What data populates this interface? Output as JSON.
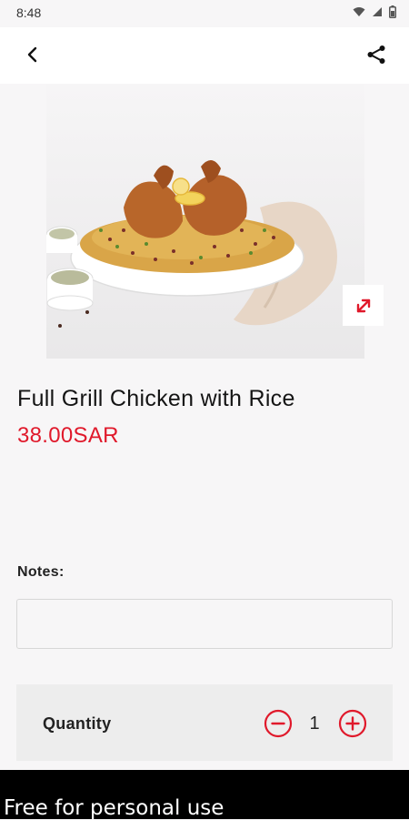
{
  "status_bar": {
    "time": "8:48",
    "icons": [
      "wifi-icon",
      "signal-icon",
      "battery-icon"
    ]
  },
  "app_bar": {
    "back_icon": "back-arrow-icon",
    "share_icon": "share-icon"
  },
  "product": {
    "name": "Full Grill Chicken with Rice",
    "price": "38.00SAR",
    "image_icon": "dish-photo",
    "expand_icon": "expand-icon"
  },
  "notes": {
    "label": "Notes:",
    "value": "",
    "placeholder": ""
  },
  "quantity": {
    "label": "Quantity",
    "value": "1",
    "minus_icon": "minus-circle-icon",
    "plus_icon": "plus-circle-icon"
  },
  "footer": {
    "text": "Free for personal use"
  },
  "colors": {
    "accent": "#e0192b",
    "background": "#f7f6f7",
    "card": "#ededed"
  }
}
